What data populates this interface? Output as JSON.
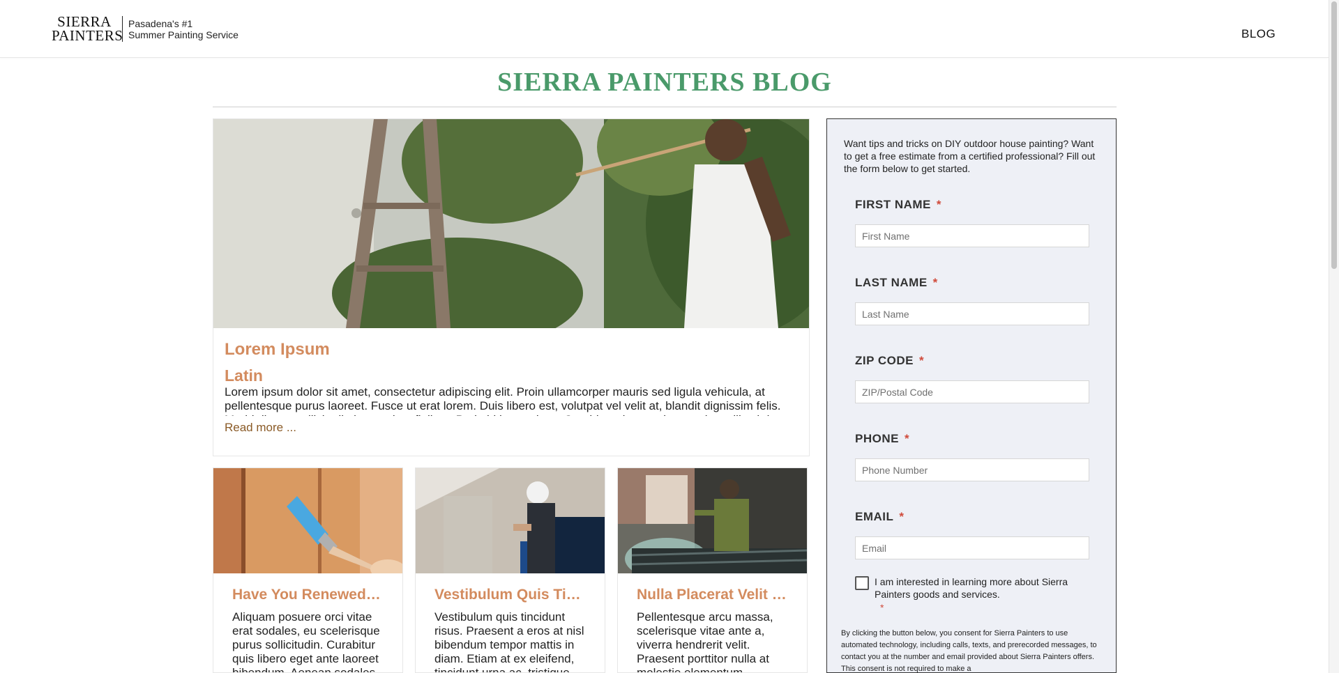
{
  "header": {
    "logo_line1": "SIERRA",
    "logo_line2": "PAINTERS",
    "tagline_line1": "Pasadena's #1",
    "tagline_line2": "Summer Painting Service",
    "nav_blog": "BLOG"
  },
  "page_title": "SIERRA PAINTERS BLOG",
  "featured": {
    "title": "Lorem Ipsum",
    "category": "Latin",
    "excerpt": "Lorem ipsum dolor sit amet, consectetur adipiscing elit. Proin ullamcorper mauris sed ligula vehicula, at pellentesque purus laoreet. Fusce ut erat lorem. Duis libero est, volutpat vel velit at, blandit dignissim felis. Morbi dictum sollicitudin lorem vitae finibus. Proin id lorem risus. Curabitur pharetra justo quis mollis ultrices. Quisque",
    "read_more": "Read more ..."
  },
  "cards": [
    {
      "title": "Have You Renewed Y...",
      "excerpt": "Aliquam posuere orci vitae erat sodales, eu scelerisque purus sollicitudin. Curabitur quis libero eget ante laoreet bibendum. Aenean sodales"
    },
    {
      "title": "Vestibulum Quis Tin...",
      "excerpt": "Vestibulum quis tincidunt risus. Praesent a eros at nisl bibendum tempor mattis in diam. Etiam at ex eleifend, tincidunt urna ac, tristique"
    },
    {
      "title": "Nulla Placerat Velit C...",
      "excerpt": "Pellentesque arcu massa, scelerisque vitae ante a, viverra hendrerit velit. Praesent porttitor nulla at molestie elementum"
    }
  ],
  "form": {
    "intro": "Want tips and tricks on DIY outdoor house painting? Want to get a free estimate from a certified professional? Fill out the form below to get started.",
    "required_mark": "*",
    "first_name_label": "FIRST NAME",
    "first_name_placeholder": "First Name",
    "last_name_label": "LAST NAME",
    "last_name_placeholder": "Last Name",
    "zip_label": "ZIP CODE",
    "zip_placeholder": "ZIP/Postal Code",
    "phone_label": "PHONE",
    "phone_placeholder": "Phone Number",
    "email_label": "EMAIL",
    "email_placeholder": "Email",
    "checkbox_label": "I am interested in learning more about Sierra Painters goods and services.",
    "consent_text": "By clicking the button below, you consent for Sierra Painters to use automated technology, including calls, texts, and prerecorded messages, to contact you at the number and email provided about Sierra Painters offers. This consent is not required to make a"
  },
  "colors": {
    "title_green": "#4a9a6a",
    "post_title_orange": "#d38b5e",
    "read_more_brown": "#8a5a26",
    "form_bg": "#eef0f6",
    "required_red": "#d04a3a"
  }
}
